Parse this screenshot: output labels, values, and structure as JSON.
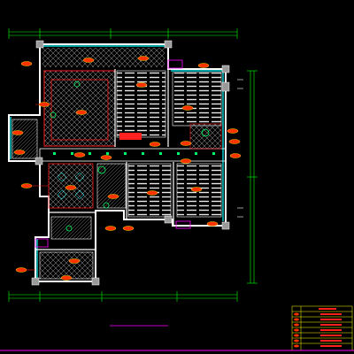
{
  "drawing": {
    "title": "",
    "background": "#000000",
    "colors": {
      "wall": "#ffffff",
      "dimension": "#00ff00",
      "cyan": "#00ffff",
      "red": "#ff2020",
      "yellow": "#ffff00",
      "magenta": "#ff00ff",
      "orange_tag": "#ff3300"
    }
  },
  "legend": {
    "rows": [
      "",
      "",
      "",
      "",
      "",
      "",
      "",
      ""
    ]
  }
}
